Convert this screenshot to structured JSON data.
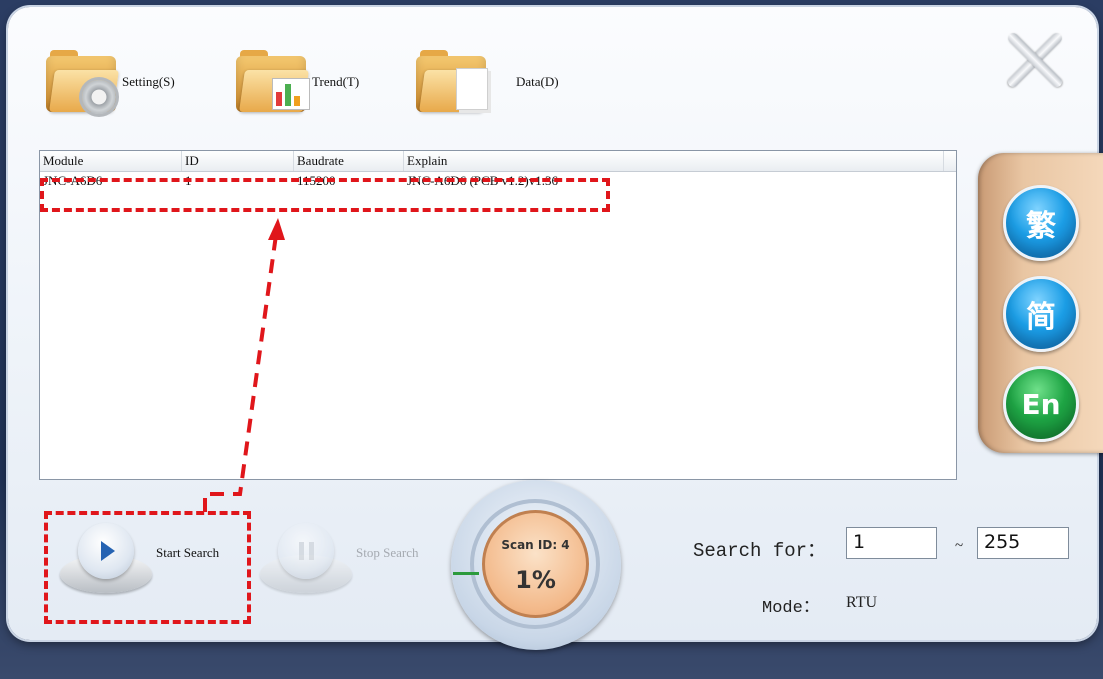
{
  "toolbar": {
    "setting_label": "Setting(S)",
    "trend_label": "Trend(T)",
    "data_label": "Data(D)"
  },
  "module_list": {
    "columns": [
      "Module",
      "ID",
      "Baudrate",
      "Explain"
    ],
    "rows": [
      {
        "module": "JNC-A6D6",
        "id": "1",
        "baudrate": "115200",
        "explain": "JNC-A6D6 (PCB v1.2)v1.36"
      }
    ]
  },
  "language": {
    "traditional": "繁",
    "simplified": "简",
    "english": "En"
  },
  "search_controls": {
    "start_label": "Start Search",
    "stop_label": "Stop Search"
  },
  "scan_status": {
    "scan_id": "Scan ID: 4",
    "progress_text": "1%",
    "progress": 0.01
  },
  "search_range": {
    "label": "Search for：",
    "from": "1",
    "to": "255",
    "separator": "~"
  },
  "mode": {
    "label": "Mode：",
    "value": "RTU"
  },
  "colors": {
    "annotation": "#e0161b",
    "progress_green": "#2c9a3c"
  }
}
